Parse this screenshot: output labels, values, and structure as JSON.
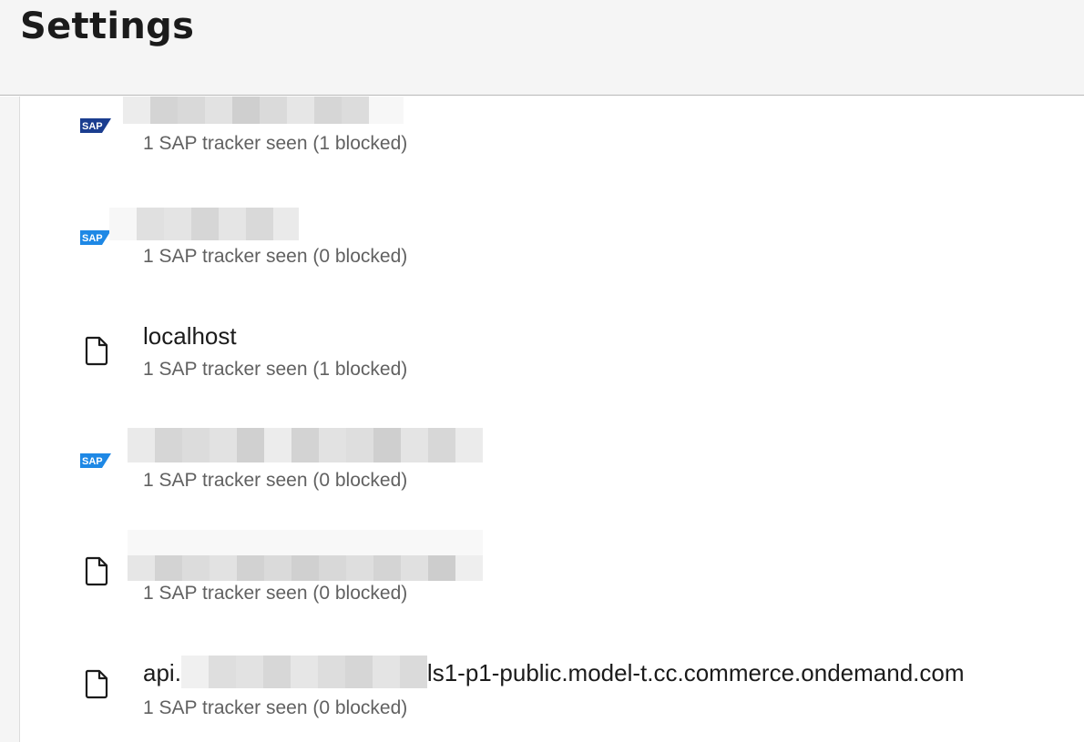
{
  "header": {
    "title": "Settings"
  },
  "sites": [
    {
      "icon": "sap-logo-icon",
      "name": "",
      "tracker_info": "1 SAP tracker seen (1 blocked)"
    },
    {
      "icon": "sap-logo-icon",
      "name": "",
      "tracker_info": "1 SAP tracker seen (0 blocked)"
    },
    {
      "icon": "file-icon",
      "name": "localhost",
      "tracker_info": "1 SAP tracker seen (1 blocked)"
    },
    {
      "icon": "sap-logo-icon",
      "name": "",
      "tracker_info": "1 SAP tracker seen (0 blocked)"
    },
    {
      "icon": "file-icon",
      "name": "",
      "tracker_info": "1 SAP tracker seen (0 blocked)"
    },
    {
      "icon": "file-icon",
      "name_prefix": "api.",
      "name_suffix": "ls1-p1-public.model-t.cc.commerce.ondemand.com",
      "tracker_info": "1 SAP tracker seen (0 blocked)"
    }
  ],
  "colors": {
    "header_bg": "#f5f5f5",
    "sap_blue": "#0a6ed1",
    "sap_dark": "#1a3d8f",
    "secondary_text": "#616161"
  }
}
